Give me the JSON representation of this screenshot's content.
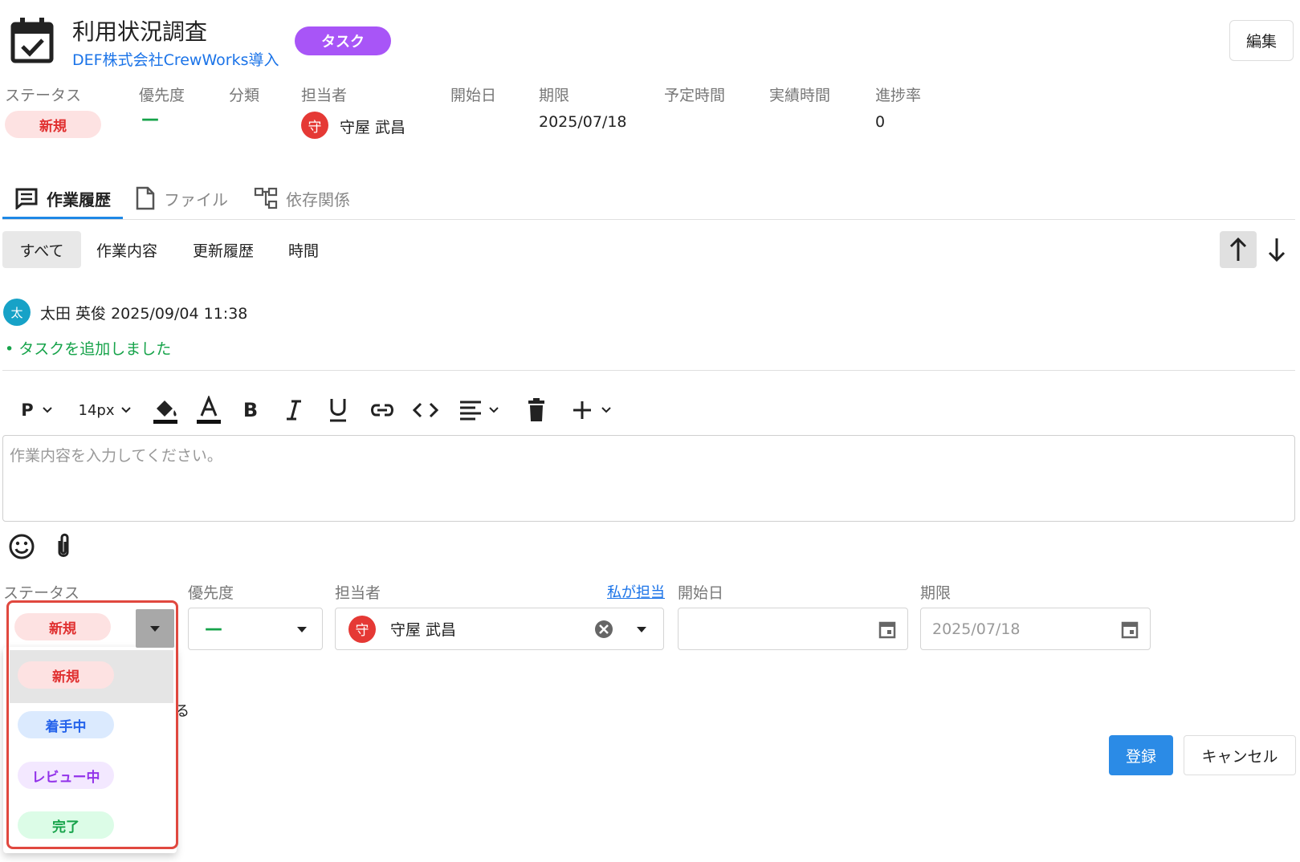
{
  "header": {
    "title": "利用状況調査",
    "project": "DEF株式会社CrewWorks導入",
    "type_badge": "タスク",
    "edit_label": "編集"
  },
  "properties": {
    "status_label": "ステータス",
    "status_value": "新規",
    "priority_label": "優先度",
    "priority_value": "—",
    "category_label": "分類",
    "assignee_label": "担当者",
    "assignee_avatar": "守",
    "assignee_name": "守屋 武昌",
    "start_label": "開始日",
    "due_label": "期限",
    "due_value": "2025/07/18",
    "planned_label": "予定時間",
    "actual_label": "実績時間",
    "progress_label": "進捗率",
    "progress_value": "0"
  },
  "tabs": [
    {
      "label": "作業履歴",
      "icon": "comment-icon",
      "active": true
    },
    {
      "label": "ファイル",
      "icon": "file-icon",
      "active": false
    },
    {
      "label": "依存関係",
      "icon": "dependency-icon",
      "active": false
    }
  ],
  "filters": [
    {
      "label": "すべて",
      "active": true
    },
    {
      "label": "作業内容",
      "active": false
    },
    {
      "label": "更新履歴",
      "active": false
    },
    {
      "label": "時間",
      "active": false
    }
  ],
  "history": {
    "avatar": "太",
    "author_time": "太田 英俊  2025/09/04 11:38",
    "entry": "•  タスクを追加しました"
  },
  "toolbar": {
    "block_format": "P",
    "font_size": "14px"
  },
  "editor": {
    "placeholder": "作業内容を入力してください。"
  },
  "form": {
    "status_label": "ステータス",
    "status_value": "新規",
    "priority_label": "優先度",
    "priority_value": "—",
    "assignee_label": "担当者",
    "assign_me": "私が担当",
    "assignee_avatar": "守",
    "assignee_name": "守屋 武昌",
    "start_label": "開始日",
    "due_label": "期限",
    "due_value": "2025/07/18",
    "submit": "登録",
    "cancel": "キャンセル",
    "hidden_fragment": "る"
  },
  "status_options": [
    "新規",
    "着手中",
    "レビュー中",
    "完了"
  ],
  "colors": {
    "accent": "#2b8be6",
    "type_badge": "#a855f7",
    "status_new": "#e03030",
    "status_wip": "#2563eb",
    "status_review": "#9333ea",
    "status_done": "#16a34a",
    "highlight_frame": "#e0483f"
  }
}
